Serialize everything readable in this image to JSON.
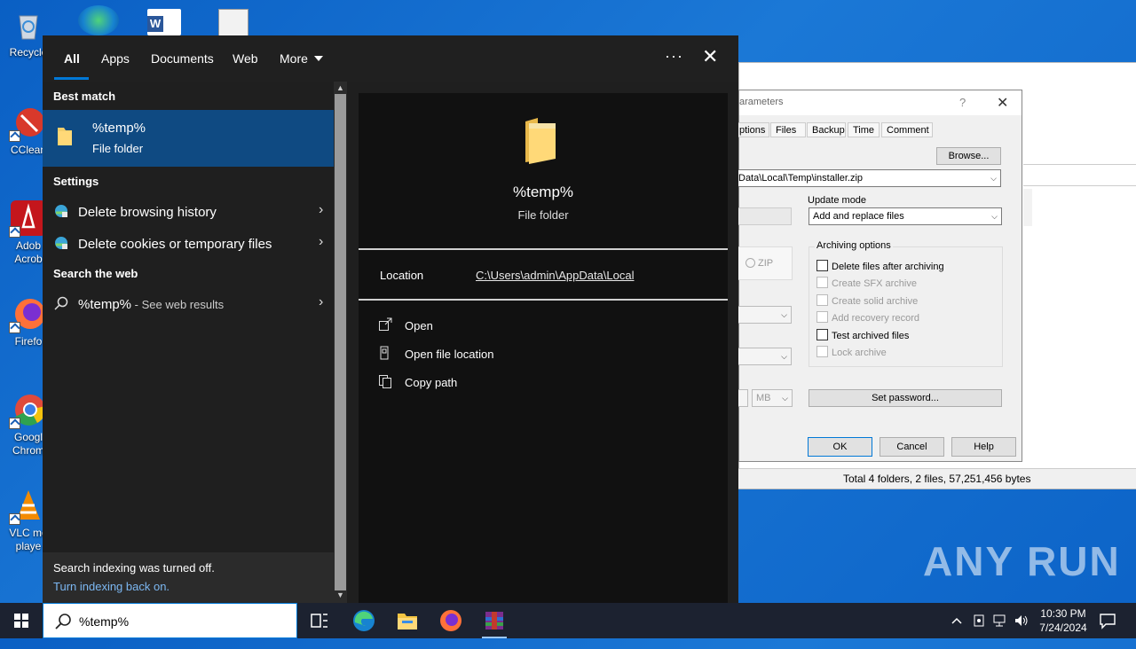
{
  "desktop": {
    "icons": [
      {
        "name": "recycle-bin",
        "label": "Recycle"
      },
      {
        "name": "ccleaner",
        "label": "CClean"
      },
      {
        "name": "adobe",
        "label": "Adob Acrob"
      },
      {
        "name": "firefox",
        "label": "Firefo"
      },
      {
        "name": "chrome",
        "label": "Googl Chrom"
      },
      {
        "name": "vlc",
        "label": "VLC me playe"
      }
    ]
  },
  "winrar": {
    "dialog_title": "arameters",
    "tabs": [
      "ptions",
      "Files",
      "Backup",
      "Time",
      "Comment"
    ],
    "browse": "Browse...",
    "path": "Data\\Local\\Temp\\installer.zip",
    "update_mode_label": "Update mode",
    "update_mode_value": "Add and replace files",
    "zip_label": "ZIP",
    "archiving_options_label": "Archiving options",
    "options": [
      {
        "label": "Delete files after archiving",
        "enabled": true
      },
      {
        "label": "Create SFX archive",
        "enabled": false
      },
      {
        "label": "Create solid archive",
        "enabled": false
      },
      {
        "label": "Add recovery record",
        "enabled": false
      },
      {
        "label": "Test archived files",
        "enabled": true
      },
      {
        "label": "Lock archive",
        "enabled": false
      }
    ],
    "mb_label": "MB",
    "set_password": "Set password...",
    "ok": "OK",
    "cancel": "Cancel",
    "help": "Help",
    "help_q": "?",
    "close_x": "✕",
    "status": "Total 4 folders, 2 files, 57,251,456 bytes"
  },
  "search": {
    "tabs": {
      "all": "All",
      "apps": "Apps",
      "documents": "Documents",
      "web": "Web",
      "more": "More"
    },
    "dots": "···",
    "close": "✕",
    "best_match_heading": "Best match",
    "best_match": {
      "title": "%temp%",
      "subtitle": "File folder"
    },
    "settings_heading": "Settings",
    "settings_items": [
      "Delete browsing history",
      "Delete cookies or temporary files"
    ],
    "web_heading": "Search the web",
    "web_item": {
      "query": "%temp%",
      "suffix": " - See web results"
    },
    "chevron": "›",
    "indexing_off": "Search indexing was turned off.",
    "indexing_link": "Turn indexing back on.",
    "preview": {
      "title": "%temp%",
      "subtitle": "File folder",
      "location_label": "Location",
      "location_value": "C:\\Users\\admin\\AppData\\Local",
      "actions": [
        "Open",
        "Open file location",
        "Copy path"
      ]
    }
  },
  "taskbar": {
    "search_value": "%temp%",
    "time": "10:30 PM",
    "date": "7/24/2024"
  },
  "watermark": "ANY RUN",
  "colors": {
    "accent": "#0078d7",
    "selected": "#0f4a82",
    "panel": "#1f1f1f"
  }
}
